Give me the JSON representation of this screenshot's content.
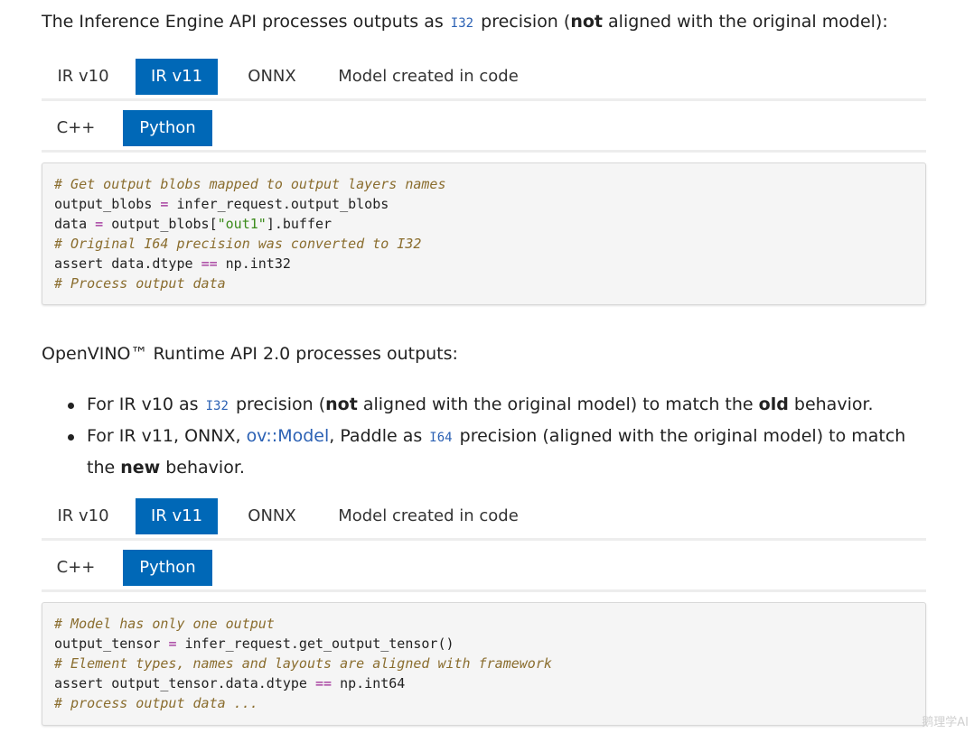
{
  "intro1": {
    "before": "The Inference Engine API processes outputs as",
    "code": "I32",
    "middle": "precision (",
    "bold": "not",
    "after": "aligned with the original model):"
  },
  "tabs1": {
    "versions": [
      "IR v10",
      "IR v11",
      "ONNX",
      "Model created in code"
    ],
    "languages": [
      "C++",
      "Python"
    ]
  },
  "code1": {
    "line1": "# Get output blobs mapped to output layers names",
    "line2_a": "output_blobs ",
    "line2_op": "=",
    "line2_b": " infer_request.output_blobs",
    "line3_a": "data ",
    "line3_op": "=",
    "line3_b": " output_blobs[",
    "line3_str": "\"out1\"",
    "line3_c": "].buffer",
    "line4": "# Original I64 precision was converted to I32",
    "line5_a": "assert data.dtype ",
    "line5_op": "==",
    "line5_b": " np.int32",
    "line6": "# Process output data"
  },
  "intro2": "OpenVINO™ Runtime API 2.0 processes outputs:",
  "bullets": {
    "b1_a": "For IR v10 as",
    "b1_code": "I32",
    "b1_b": "precision (",
    "b1_bold1": "not",
    "b1_c": "aligned with the original model) to match the",
    "b1_bold2": "old",
    "b1_d": "behavior.",
    "b2_a": "For IR v11, ONNX,",
    "b2_link": "ov::Model",
    "b2_b": ", Paddle as",
    "b2_code": "I64",
    "b2_c": "precision (aligned with the original model) to match",
    "b2_d": "the",
    "b2_bold": "new",
    "b2_e": "behavior."
  },
  "tabs2": {
    "versions": [
      "IR v10",
      "IR v11",
      "ONNX",
      "Model created in code"
    ],
    "languages": [
      "C++",
      "Python"
    ]
  },
  "code2": {
    "line1": "# Model has only one output",
    "line2_a": "output_tensor ",
    "line2_op": "=",
    "line2_b": " infer_request.get_output_tensor()",
    "line3": "# Element types, names and layouts are aligned with framework",
    "line4_a": "assert output_tensor.data.dtype ",
    "line4_op": "==",
    "line4_b": " np.int64",
    "line5": "# process output data ..."
  },
  "colors": {
    "active_tab": "#0068b7",
    "link": "#2b61b4",
    "comment": "#8a6d2e",
    "string": "#3b8a1a",
    "operator": "#9b2393"
  },
  "watermark": "鹅理学AI"
}
